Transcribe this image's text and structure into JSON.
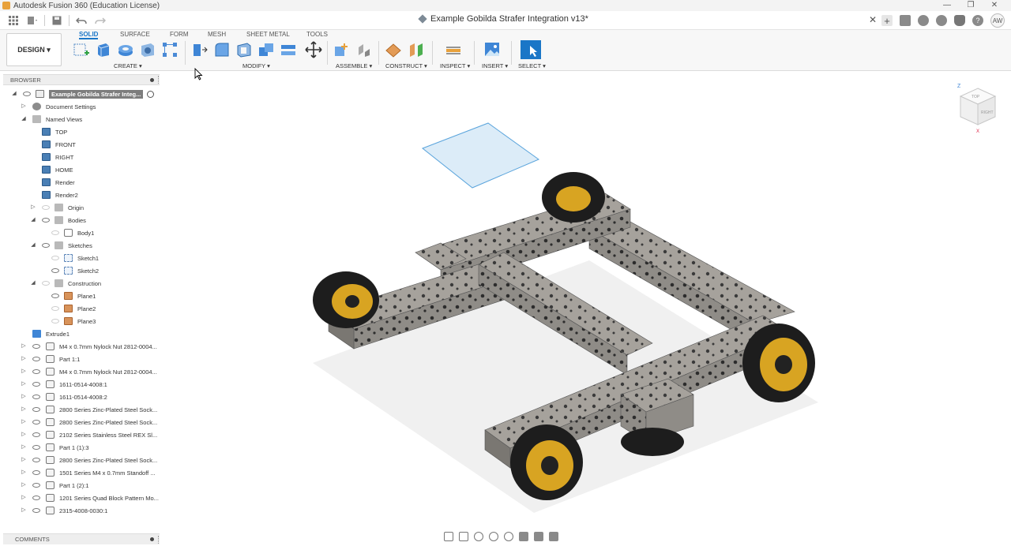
{
  "window": {
    "title": "Autodesk Fusion 360 (Education License)",
    "minimize": "—",
    "restore": "❐",
    "close": "✕"
  },
  "tabbar": {
    "document_title": "Example Gobilda Strafer Integration v13*",
    "close": "✕",
    "avatar_initials": "AW"
  },
  "toolbar": {
    "workspace": "DESIGN ▾",
    "tabs": [
      "SOLID",
      "SURFACE",
      "FORM",
      "MESH",
      "SHEET METAL",
      "TOOLS"
    ],
    "active_tab": "SOLID",
    "groups": {
      "create": "CREATE ▾",
      "modify": "MODIFY ▾",
      "assemble": "ASSEMBLE ▾",
      "construct": "CONSTRUCT ▾",
      "inspect": "INSPECT ▾",
      "insert": "INSERT ▾",
      "select": "SELECT ▾"
    }
  },
  "browser": {
    "header": "BROWSER",
    "root": "Example Gobilda Strafer Integ...",
    "items": [
      {
        "label": "Document Settings"
      },
      {
        "label": "Named Views"
      },
      {
        "label": "TOP"
      },
      {
        "label": "FRONT"
      },
      {
        "label": "RIGHT"
      },
      {
        "label": "HOME"
      },
      {
        "label": "Render"
      },
      {
        "label": "Render2"
      },
      {
        "label": "Origin"
      },
      {
        "label": "Bodies"
      },
      {
        "label": "Body1"
      },
      {
        "label": "Sketches"
      },
      {
        "label": "Sketch1"
      },
      {
        "label": "Sketch2"
      },
      {
        "label": "Construction"
      },
      {
        "label": "Plane1"
      },
      {
        "label": "Plane2"
      },
      {
        "label": "Plane3"
      },
      {
        "label": "Extrude1"
      },
      {
        "label": "M4 x 0.7mm Nylock Nut 2812-0004..."
      },
      {
        "label": "Part 1:1"
      },
      {
        "label": "M4 x 0.7mm Nylock Nut 2812-0004..."
      },
      {
        "label": "1611-0514-4008:1"
      },
      {
        "label": "1611-0514-4008:2"
      },
      {
        "label": "2800 Series Zinc-Plated Steel Sock..."
      },
      {
        "label": "2800 Series Zinc-Plated Steel Sock..."
      },
      {
        "label": "2102 Series Stainless Steel REX Sl..."
      },
      {
        "label": "Part 1 (1):3"
      },
      {
        "label": "2800 Series Zinc-Plated Steel Sock..."
      },
      {
        "label": "1501 Series M4 x 0.7mm Standoff ..."
      },
      {
        "label": "Part 1 (2):1"
      },
      {
        "label": "1201 Series Quad Block Pattern Mo..."
      },
      {
        "label": "2315-4008-0030:1"
      }
    ]
  },
  "comments": {
    "header": "COMMENTS"
  },
  "viewcube": {
    "face_top": "TOP",
    "face_right": "RIGHT",
    "axis_z": "Z",
    "axis_x": "X"
  },
  "colors": {
    "accent": "#1a76c7",
    "frame": "#8f8c87",
    "wheel": "#d8a422",
    "plane": "#cfe6f7"
  }
}
